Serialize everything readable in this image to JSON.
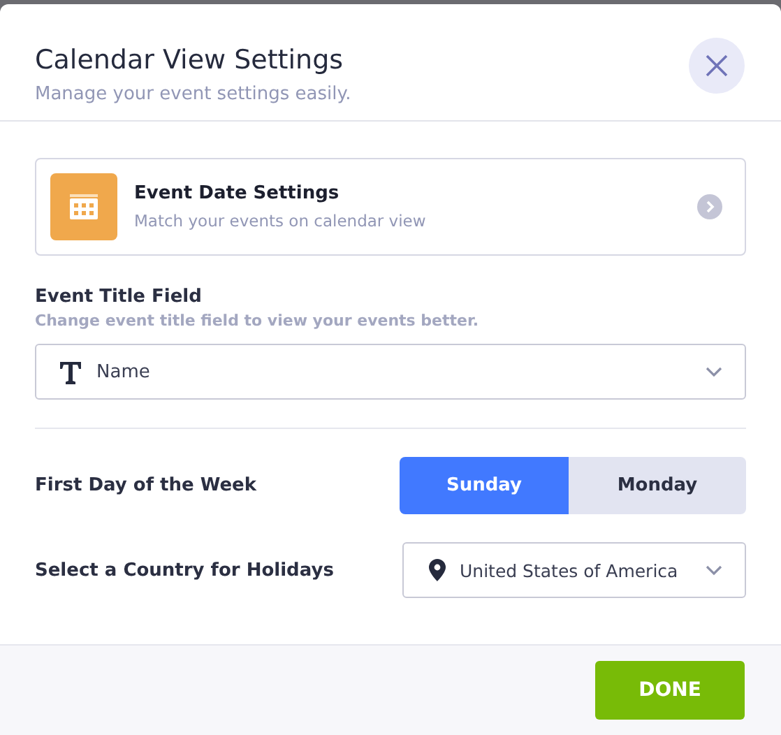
{
  "dialog": {
    "title": "Calendar View Settings",
    "subtitle": "Manage your event settings easily."
  },
  "date_settings_card": {
    "title": "Event Date Settings",
    "description": "Match your events on calendar view"
  },
  "event_title_field": {
    "label": "Event Title Field",
    "hint": "Change event title field to view your events better.",
    "value": "Name"
  },
  "first_day": {
    "label": "First Day of the Week",
    "options": [
      {
        "label": "Sunday",
        "selected": true
      },
      {
        "label": "Monday",
        "selected": false
      }
    ]
  },
  "country": {
    "label": "Select a Country for Holidays",
    "value": "United States of America"
  },
  "footer": {
    "done_button": "DONE"
  }
}
